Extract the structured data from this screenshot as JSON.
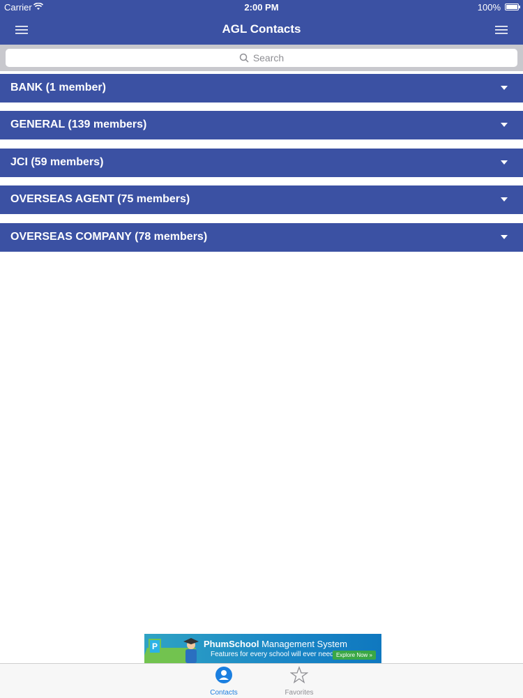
{
  "status_bar": {
    "carrier": "Carrier",
    "time": "2:00 PM",
    "battery": "100%"
  },
  "nav": {
    "title": "AGL Contacts"
  },
  "search": {
    "placeholder": "Search"
  },
  "groups": [
    {
      "label": "BANK (1 member)"
    },
    {
      "label": "GENERAL (139 members)"
    },
    {
      "label": "JCI (59 members)"
    },
    {
      "label": "OVERSEAS AGENT (75 members)"
    },
    {
      "label": "OVERSEAS COMPANY (78 members)"
    }
  ],
  "ad": {
    "brand": "PhumSchool",
    "title_rest": " Management System",
    "tagline": "Features for every school will ever need",
    "cta": "Explore Now »"
  },
  "tabs": [
    {
      "label": "Contacts",
      "icon": "contacts-icon",
      "active": true
    },
    {
      "label": "Favorites",
      "icon": "star-icon",
      "active": false
    }
  ],
  "colors": {
    "primary": "#3b51a3",
    "active_tab": "#1b7fe0",
    "inactive_tab": "#8e8e93"
  }
}
